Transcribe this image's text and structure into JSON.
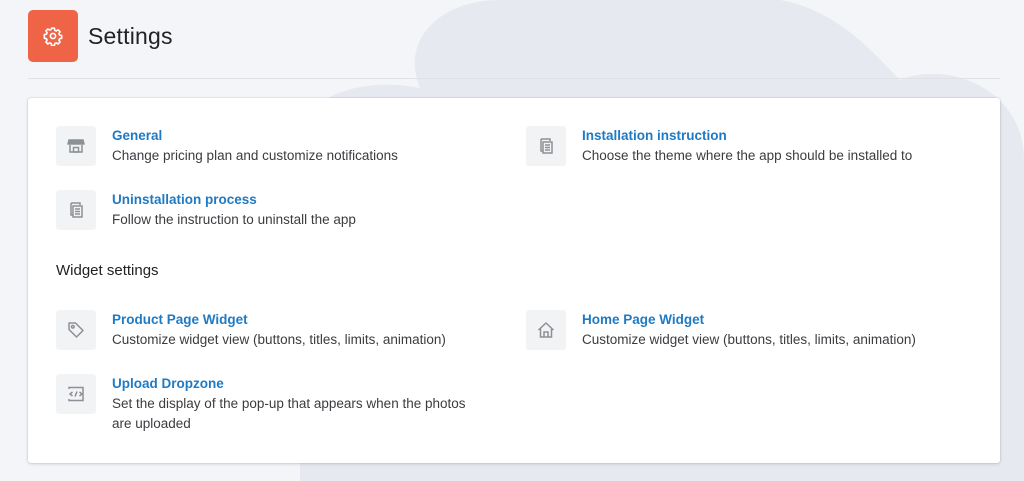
{
  "header": {
    "title": "Settings",
    "icon": "gear-icon",
    "icon_bg": "#ef6347"
  },
  "general_items": [
    {
      "title": "General",
      "desc": "Change pricing plan and customize notifications",
      "icon": "store-icon"
    },
    {
      "title": "Installation instruction",
      "desc": "Choose the theme where the app should be installed to",
      "icon": "documents-icon"
    },
    {
      "title": "Uninstallation process",
      "desc": "Follow the instruction to uninstall the app",
      "icon": "documents-icon"
    }
  ],
  "widget_section": {
    "title": "Widget settings",
    "items": [
      {
        "title": "Product Page Widget",
        "desc": "Customize widget view (buttons, titles, limits, animation)",
        "icon": "tag-icon"
      },
      {
        "title": "Home Page Widget",
        "desc": "Customize widget view (buttons, titles, limits, animation)",
        "icon": "home-icon"
      },
      {
        "title": "Upload Dropzone",
        "desc_line1": "Set the display of the pop-up that appears when the photos",
        "desc_line2": "are uploaded",
        "icon": "code-icon"
      }
    ]
  },
  "colors": {
    "link": "#1f7ac4",
    "accent": "#ef6347",
    "background": "#f4f5f8"
  }
}
